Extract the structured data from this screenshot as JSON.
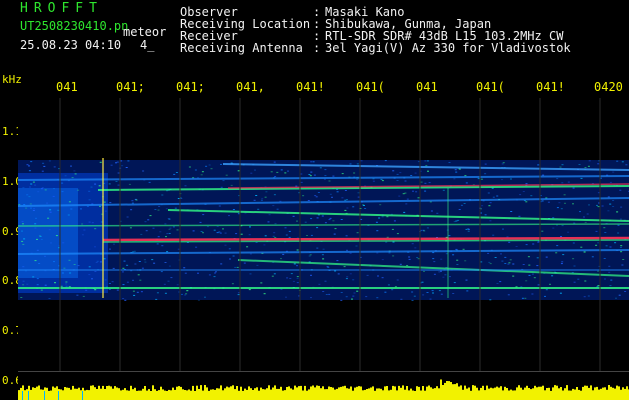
{
  "header": {
    "app_title": "HROFFT",
    "file_name": "UT2508230410.pn",
    "meteor_label": "meteor",
    "datetime": "25.08.23 04:10",
    "count": "4_",
    "info": [
      {
        "label": "Observer",
        "sep": ":",
        "value": "Masaki Kano"
      },
      {
        "label": "Receiving Location",
        "sep": ":",
        "value": "Shibukawa, Gunma, Japan"
      },
      {
        "label": "Receiver",
        "sep": ":",
        "value": "RTL-SDR SDR# 43dB L15 103.2MHz CW"
      },
      {
        "label": "Receiving Antenna",
        "sep": ":",
        "value": "3el Yagi(V) Az 330 for Vladivostok"
      }
    ]
  },
  "axis": {
    "unit": "kHz",
    "time_ticks": [
      "041",
      "041;",
      "041;",
      "041,",
      "041!",
      "041(",
      "041",
      "041(",
      "041!",
      "0420"
    ],
    "freq_ticks": [
      "1.1",
      "1.0",
      "0.9",
      "0.8",
      "0.7",
      "0.6"
    ]
  },
  "colors": {
    "background": "#000000",
    "header_green": "#2ee62e",
    "text_white": "#f2f2f2",
    "axis_yellow": "#f2f200",
    "signal_red": "#ff3355",
    "signal_green": "#33ff88",
    "signal_cyan": "#00b4ff",
    "noise_blue": "#0033cc"
  }
}
